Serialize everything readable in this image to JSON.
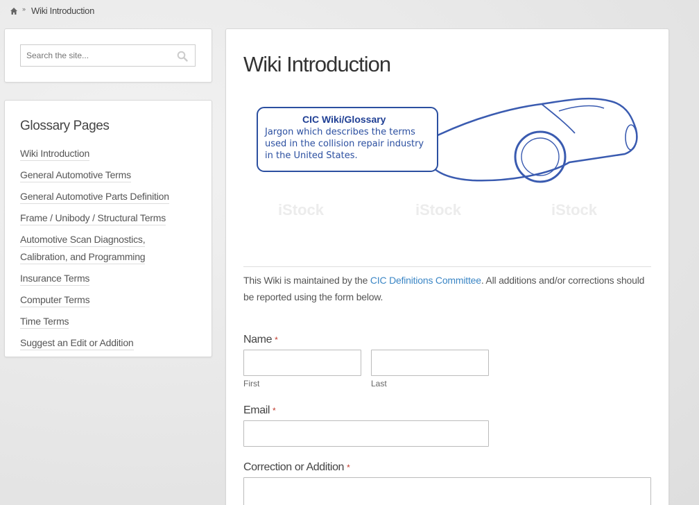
{
  "breadcrumb": {
    "current": "Wiki Introduction"
  },
  "search": {
    "placeholder": "Search the site..."
  },
  "sidebar": {
    "title": "Glossary Pages",
    "items": [
      "Wiki Introduction",
      "General Automotive Terms",
      "General Automotive Parts Definition",
      "Frame / Unibody / Structural Terms",
      "Automotive Scan Diagnostics, Calibration, and Programming",
      "Insurance Terms",
      "Computer Terms",
      "Time Terms",
      "Suggest an Edit or Addition"
    ]
  },
  "main": {
    "title": "Wiki Introduction",
    "banner": {
      "heading": "CIC Wiki/Glossary",
      "line1": "Jargon which describes the terms",
      "line2": "used in the collision repair industry",
      "line3": "in the United States.",
      "watermark": "iStock"
    },
    "intro_before": "This Wiki is maintained by the ",
    "intro_link": "CIC Definitions Committee",
    "intro_after": ". All additions and/or corrections should be reported using the form below."
  },
  "form": {
    "name_label": "Name",
    "first_label": "First",
    "last_label": "Last",
    "email_label": "Email",
    "correction_label": "Correction or Addition",
    "required_mark": "*"
  },
  "colors": {
    "accent": "#3b86c5",
    "banner_blue": "#2b4fa0",
    "required": "#c0392b"
  }
}
